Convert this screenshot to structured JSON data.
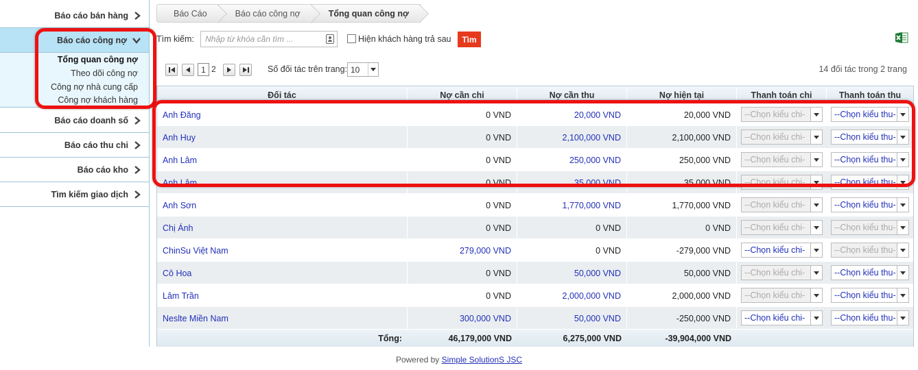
{
  "sidebar": {
    "items": [
      {
        "label": "Báo cáo bán hàng"
      },
      {
        "label": "Báo cáo công nợ"
      },
      {
        "label": "Báo cáo doanh số"
      },
      {
        "label": "Báo cáo thu chi"
      },
      {
        "label": "Báo cáo kho"
      },
      {
        "label": "Tìm kiếm giao dịch"
      }
    ],
    "submenu": [
      {
        "label": "Tổng quan công nợ"
      },
      {
        "label": "Theo dõi công nợ"
      },
      {
        "label": "Công nợ nhà cung cấp"
      },
      {
        "label": "Công nợ khách hàng"
      }
    ]
  },
  "breadcrumb": [
    "Báo Cáo",
    "Báo cáo công nợ",
    "Tổng quan công nợ"
  ],
  "search": {
    "label": "Tìm kiếm:",
    "placeholder": "Nhập từ khóa cần tìm ...",
    "postpay_label": "Hiện khách hàng trả sau",
    "find_label": "Tìm"
  },
  "pager": {
    "current_page": "1",
    "next_page": "2",
    "per_page_label": "Số đối tác trên trang:",
    "per_page_value": "10",
    "count_info": "14 đối tác trong 2 trang"
  },
  "table": {
    "headers": [
      "Đối tác",
      "Nợ cần chi",
      "Nợ cần thu",
      "Nợ hiện tại",
      "Thanh toán chi",
      "Thanh toán thu"
    ],
    "select_chi_placeholder": "--Chọn kiểu chi-",
    "select_thu_placeholder": "--Chọn kiểu thu-",
    "rows": [
      {
        "name": "Anh Đăng",
        "chi": "0 VND",
        "thu": "20,000 VND",
        "current": "20,000 VND"
      },
      {
        "name": "Anh Huy",
        "chi": "0 VND",
        "thu": "2,100,000 VND",
        "current": "2,100,000 VND"
      },
      {
        "name": "Anh Lâm",
        "chi": "0 VND",
        "thu": "250,000 VND",
        "current": "250,000 VND"
      },
      {
        "name": "Anh Lâm",
        "chi": "0 VND",
        "thu": "35,000 VND",
        "current": "35,000 VND"
      },
      {
        "name": "Anh Sơn",
        "chi": "0 VND",
        "thu": "1,770,000 VND",
        "current": "1,770,000 VND"
      },
      {
        "name": "Chị Ánh",
        "chi": "0 VND",
        "thu": "0 VND",
        "current": "0 VND"
      },
      {
        "name": "ChinSu Việt Nam",
        "chi": "279,000 VND",
        "thu": "0 VND",
        "current": "-279,000 VND"
      },
      {
        "name": "Cô Hoa",
        "chi": "0 VND",
        "thu": "50,000 VND",
        "current": "50,000 VND"
      },
      {
        "name": "Lâm Trần",
        "chi": "0 VND",
        "thu": "2,000,000 VND",
        "current": "2,000,000 VND"
      },
      {
        "name": "Neslte Miền Nam",
        "chi": "300,000 VND",
        "thu": "50,000 VND",
        "current": "-250,000 VND"
      }
    ],
    "total": {
      "label": "Tổng:",
      "chi": "46,179,000 VND",
      "thu": "6,275,000 VND",
      "current": "-39,904,000 VND"
    }
  },
  "footer": {
    "prefix": "Powered by",
    "link": "Simple SolutionS JSC"
  },
  "colors": {
    "link": "#2230b8",
    "accent_red": "#e63a1e",
    "active_bg": "#b8e2f5",
    "annotation": "#ee1111"
  }
}
